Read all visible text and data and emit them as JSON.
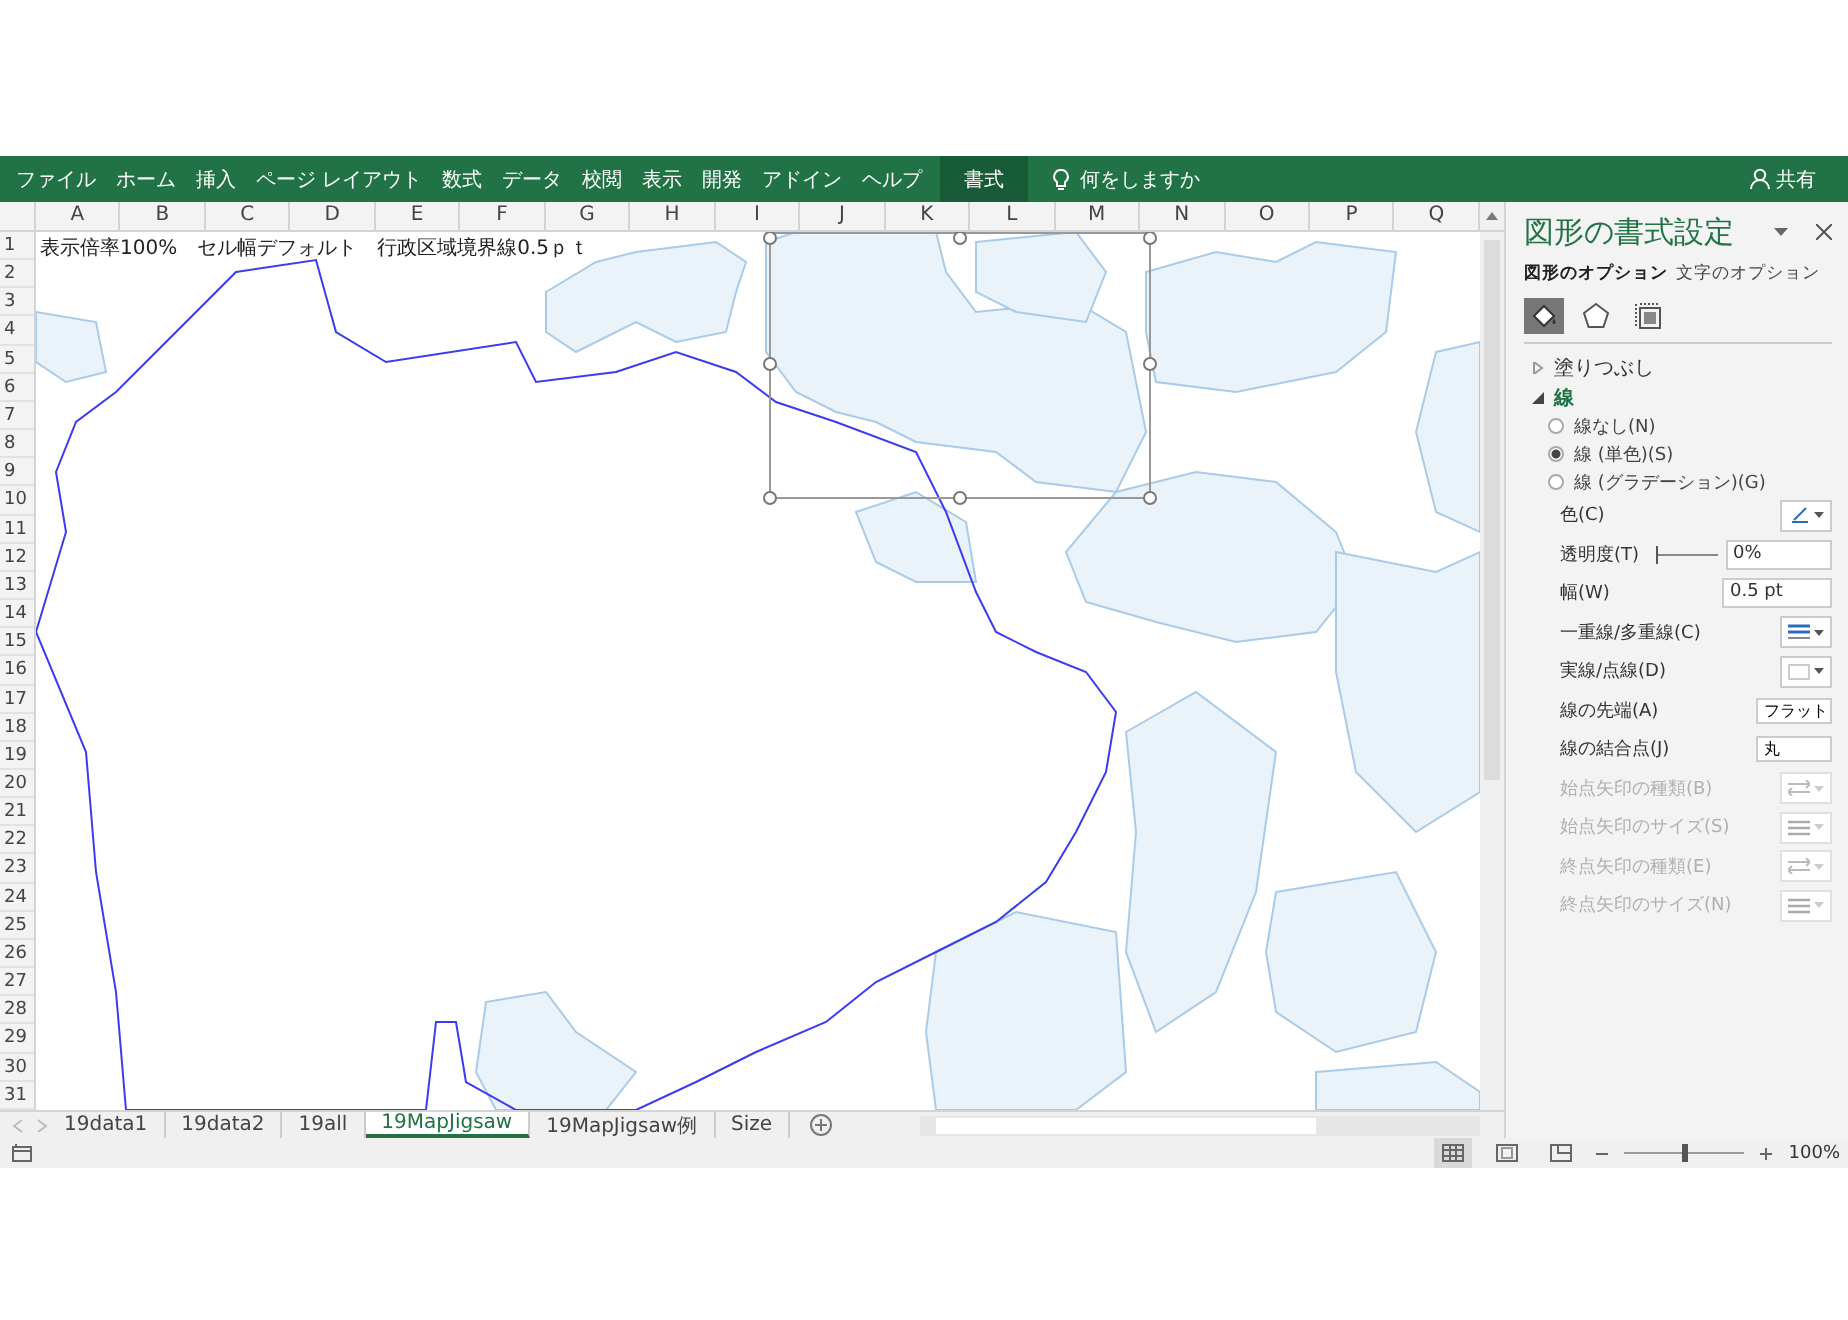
{
  "ribbon": {
    "tabs": [
      {
        "label": "ファイル",
        "selected": false
      },
      {
        "label": "ホーム",
        "selected": false
      },
      {
        "label": "挿入",
        "selected": false
      },
      {
        "label": "ページ レイアウト",
        "selected": false
      },
      {
        "label": "数式",
        "selected": false
      },
      {
        "label": "データ",
        "selected": false
      },
      {
        "label": "校閲",
        "selected": false
      },
      {
        "label": "表示",
        "selected": false
      },
      {
        "label": "開発",
        "selected": false
      },
      {
        "label": "アドイン",
        "selected": false
      },
      {
        "label": "ヘルプ",
        "selected": false
      },
      {
        "label": "書式",
        "selected": true
      }
    ],
    "tell_me": "何をしますか",
    "share": "共有"
  },
  "sheet": {
    "columns": [
      "A",
      "B",
      "C",
      "D",
      "E",
      "F",
      "G",
      "H",
      "I",
      "J",
      "K",
      "L",
      "M",
      "N",
      "O",
      "P",
      "Q"
    ],
    "rows": [
      "1",
      "2",
      "3",
      "4",
      "5",
      "6",
      "7",
      "8",
      "9",
      "10",
      "11",
      "12",
      "13",
      "14",
      "15",
      "16",
      "17",
      "18",
      "19",
      "20",
      "21",
      "22",
      "23",
      "24",
      "25",
      "26",
      "27",
      "28",
      "29",
      "30",
      "31"
    ],
    "cell_a1": "表示倍率100%　セル幅デフォルト　行政区域境界線0.5ｐｔ"
  },
  "sheet_tabs": [
    {
      "label": "19data1",
      "selected": false
    },
    {
      "label": "19data2",
      "selected": false
    },
    {
      "label": "19all",
      "selected": false
    },
    {
      "label": "19MapJigsaw",
      "selected": true
    },
    {
      "label": "19MapJigsaw例",
      "selected": false
    },
    {
      "label": "Size",
      "selected": false
    }
  ],
  "format_pane": {
    "title": "図形の書式設定",
    "tabs": [
      {
        "label": "図形のオプション",
        "selected": true
      },
      {
        "label": "文字のオプション",
        "selected": false
      }
    ],
    "icon_tabs": [
      {
        "kind": "fill",
        "selected": true
      },
      {
        "kind": "effects",
        "selected": false
      },
      {
        "kind": "size",
        "selected": false
      }
    ],
    "sections": [
      {
        "label": "塗りつぶし",
        "expanded": false
      },
      {
        "label": "線",
        "expanded": true
      }
    ],
    "radios": [
      {
        "label": "線なし(N)",
        "selected": false
      },
      {
        "label": "線 (単色)(S)",
        "selected": true
      },
      {
        "label": "線 (グラデーション)(G)",
        "selected": false
      }
    ],
    "properties": [
      {
        "label": "色(C)",
        "kind": "color",
        "disabled": false
      },
      {
        "label": "透明度(T)",
        "kind": "slider",
        "value": "0%",
        "level": 0,
        "disabled": false
      },
      {
        "label": "幅(W)",
        "kind": "spin",
        "value": "0.5 pt",
        "disabled": false
      },
      {
        "label": "一重線/多重線(C)",
        "kind": "compound",
        "disabled": false
      },
      {
        "label": "実線/点線(D)",
        "kind": "dash",
        "disabled": false
      },
      {
        "label": "線の先端(A)",
        "kind": "dropdown",
        "value": "フラット",
        "disabled": false
      },
      {
        "label": "線の結合点(J)",
        "kind": "dropdown",
        "value": "丸",
        "disabled": false
      },
      {
        "label": "始点矢印の種類(B)",
        "kind": "arrow-type",
        "disabled": true
      },
      {
        "label": "始点矢印のサイズ(S)",
        "kind": "arrow-size",
        "disabled": true
      },
      {
        "label": "終点矢印の種類(E)",
        "kind": "arrow-type",
        "disabled": true
      },
      {
        "label": "終点矢印のサイズ(N)",
        "kind": "arrow-size",
        "disabled": true
      }
    ]
  },
  "status_bar": {
    "views": [
      {
        "kind": "normal",
        "selected": true
      },
      {
        "kind": "page-layout",
        "selected": false
      },
      {
        "kind": "page-break",
        "selected": false
      }
    ],
    "zoom": {
      "level": 0.5,
      "reading": "100%"
    }
  }
}
